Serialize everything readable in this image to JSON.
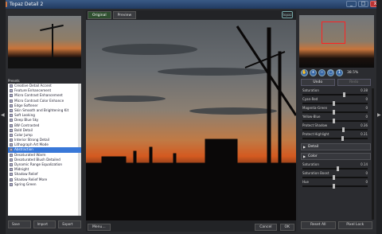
{
  "window": {
    "title": "Topaz Detail 2",
    "min": "_",
    "max": "□",
    "close": "x"
  },
  "presets": {
    "header": "Presets",
    "items": [
      "Creative Detail Accent",
      "Feature Enhancement",
      "Micro Contrast Enhancement",
      "Micro Contrast Color Enhance",
      "Edge Softener",
      "Skin Smooth and Brightening Kit",
      "Soft Looking",
      "Deep Blue Sky",
      "BW Contrasted",
      "Bold Detail",
      "Color Jump",
      "Interior Strong Detail",
      "Lithograph Art Mode",
      "Abstraction",
      "Desaturated Warm",
      "Desaturated Blush Detailed",
      "Dynamic Range Equalization",
      "Midnight",
      "Shadow Relief",
      "Shadow Relief More",
      "Spring Green"
    ],
    "selected_index": 13,
    "buttons": [
      "Save",
      "Import",
      "Export"
    ]
  },
  "center": {
    "tab_original": "Original",
    "tab_preview": "Preview",
    "logo": "topaz",
    "menu": "Menu...",
    "cancel": "Cancel",
    "ok": "OK"
  },
  "right": {
    "zoom": "38.5%",
    "undo": "Undo",
    "redo": "Redo",
    "sliders_top": [
      {
        "label": "Saturation",
        "value": "0.38"
      },
      {
        "label": "Cyan-Red",
        "value": "0"
      },
      {
        "label": "Magenta-Green",
        "value": "0"
      },
      {
        "label": "Yellow-Blue",
        "value": "0"
      },
      {
        "label": "Protect Shadow",
        "value": "0.36"
      },
      {
        "label": "Protect Highlight",
        "value": "0.31"
      }
    ],
    "section_detail": "Detail",
    "section_color": "Color",
    "sliders_bottom": [
      {
        "label": "Saturation",
        "value": "0.14"
      },
      {
        "label": "Saturation Boost",
        "value": "0"
      },
      {
        "label": "Hue",
        "value": "0"
      }
    ],
    "reset": "Reset All",
    "pixel_lock": "Pixel Lock"
  },
  "colors": {
    "selection": "#3978d8",
    "titlebar": "#2d4d78"
  }
}
